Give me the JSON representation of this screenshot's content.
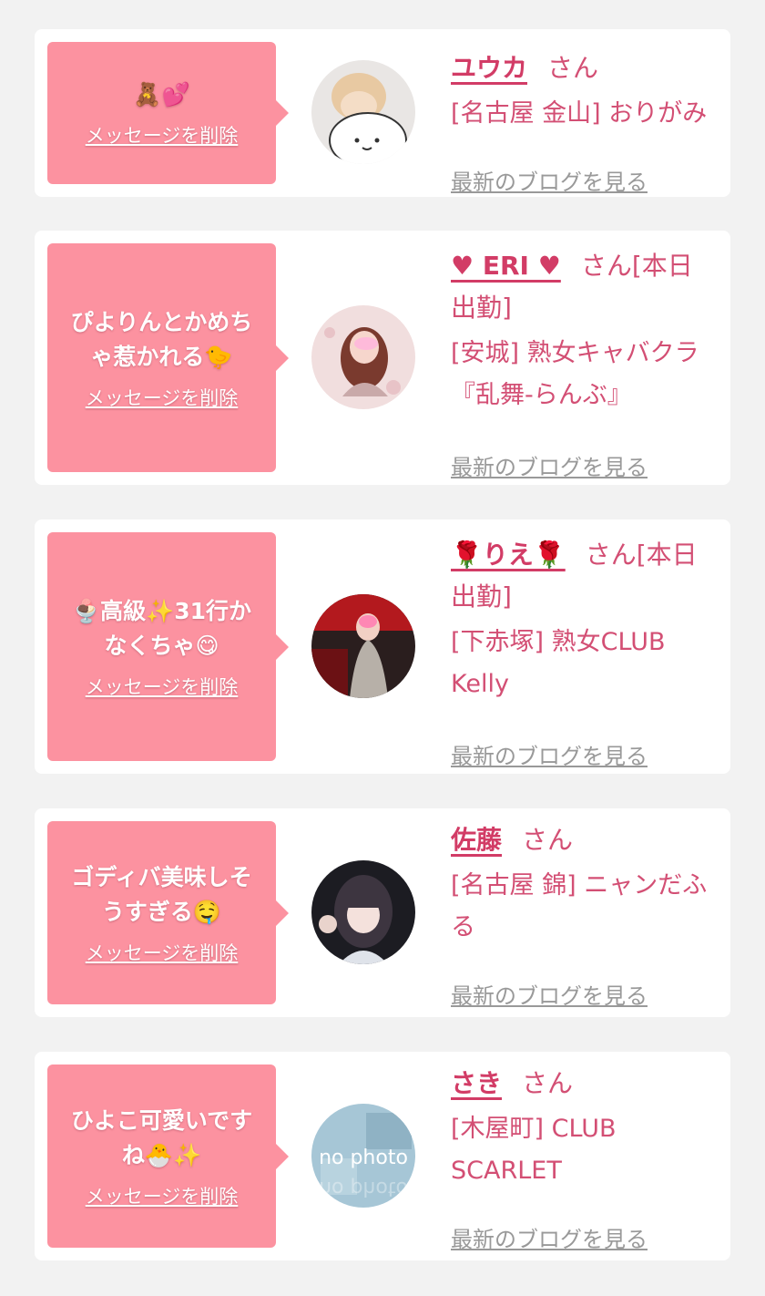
{
  "delete_label": "メッセージを削除",
  "honorific": "さん",
  "blog_label": "最新のブログを見る",
  "colors": {
    "accent": "#d23c66",
    "bubble": "#fc92a0",
    "background": "#f2f2f2"
  },
  "cards": [
    {
      "message": "🧸💕",
      "name": "ユウカ",
      "suffix": "",
      "shop": "[名古屋 金山] おりがみ",
      "avatar_icon": "white-bear-photo"
    },
    {
      "message": "ぴよりんとかめちゃ惹かれる🐤",
      "name": "♥ ERI ♥",
      "suffix": "[本日出勤]",
      "shop": "[安城] 熟女キャバクラ『乱舞-らんぶ』",
      "avatar_icon": "woman-photo"
    },
    {
      "message": "🍨高級✨31行かなくちゃ😋",
      "name": "🌹りえ🌹",
      "suffix": "[本日出勤]",
      "shop": "[下赤塚] 熟女CLUB Kelly",
      "avatar_icon": "woman-dress-photo"
    },
    {
      "message": "ゴディバ美味しそうすぎる🤤",
      "name": "佐藤",
      "suffix": "",
      "shop": "[名古屋 錦] ニャンだふる",
      "avatar_icon": "woman-bangs-photo"
    },
    {
      "message": "ひよこ可愛いですね🐣✨",
      "name": "さき",
      "suffix": "",
      "shop": "[木屋町] CLUB SCARLET",
      "avatar_icon": "no-photo-placeholder",
      "avatar_text": "no photo"
    }
  ]
}
